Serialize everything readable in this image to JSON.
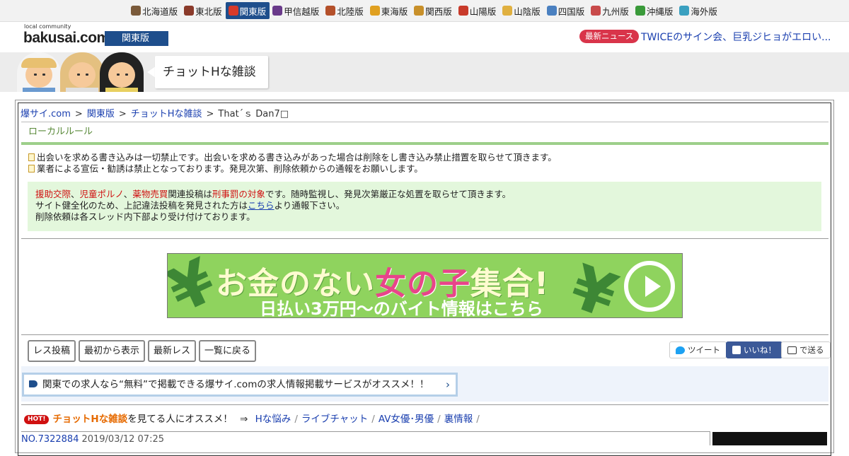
{
  "regions": [
    {
      "label": "北海道版",
      "color": "#7a5a3a",
      "icon": "cow-icon"
    },
    {
      "label": "東北版",
      "color": "#8a3a2a",
      "icon": "mask-icon"
    },
    {
      "label": "関東版",
      "color": "#d83a2a",
      "icon": "tower-icon",
      "active": true
    },
    {
      "label": "甲信越版",
      "color": "#6a3a8a",
      "icon": "grape-icon"
    },
    {
      "label": "北陸版",
      "color": "#b4502a",
      "icon": "gate-icon"
    },
    {
      "label": "東海版",
      "color": "#e0a020",
      "icon": "fish-icon"
    },
    {
      "label": "関西版",
      "color": "#c8902a",
      "icon": "takoyaki-icon"
    },
    {
      "label": "山陽版",
      "color": "#c83a2a",
      "icon": "shrine-icon"
    },
    {
      "label": "山陰版",
      "color": "#e0b040",
      "icon": "noodle-icon"
    },
    {
      "label": "四国版",
      "color": "#4a80c0",
      "icon": "bowl-icon"
    },
    {
      "label": "九州版",
      "color": "#c84a4a",
      "icon": "fish-icon"
    },
    {
      "label": "沖縄版",
      "color": "#3a9a3a",
      "icon": "shisa-icon"
    },
    {
      "label": "海外版",
      "color": "#3aa0c0",
      "icon": "globe-icon"
    }
  ],
  "header": {
    "logo_small": "local community",
    "logo_main": "bakusai.com",
    "region_badge": "関東版",
    "news_badge": "最新ニュース",
    "news_text": "TWICEのサイン会、巨乳ジヒョがエロい..."
  },
  "board": {
    "title": "チョットHな雑談"
  },
  "breadcrumb": {
    "items": [
      "爆サイ.com",
      "関東版",
      "チョットHな雑談"
    ],
    "separator": ">",
    "current": "That´ｓ Dan7□"
  },
  "local_rules": {
    "title": "ローカルルール",
    "lines": [
      "出会いを求める書き込みは一切禁止です。出会いを求める書き込みがあった場合は削除をし書き込み禁止措置を取らせて頂きます。",
      "業者による宣伝・勧誘は禁止となっております。発見次第、削除依頼からの通報をお願いします。"
    ]
  },
  "notice": {
    "red1": "援助交際",
    "comma1": "、",
    "red2": "児童ポルノ",
    "comma2": "、",
    "red3": "薬物売買",
    "mid1": "関連投稿は",
    "red4": "刑事罰の対象",
    "tail1": "です。随時監視し、発見次第厳正な処置を取らせて頂きます。",
    "line2_a": "サイト健全化のため、上記違法投稿を発見された方は",
    "line2_link": "こちら",
    "line2_b": "より通報下さい。",
    "line3": "削除依頼は各スレッド内下部より受け付けております。"
  },
  "ad": {
    "title_a": "お金のない",
    "title_pink": "女の子",
    "title_b": "集合!",
    "subtitle": "日払い3万円～のバイト情報はこちら",
    "yen": "¥"
  },
  "toolbar": {
    "post": "レス投稿",
    "first": "最初から表示",
    "latest": "最新レス",
    "back": "一覧に戻る"
  },
  "share": {
    "tweet": "ツイート",
    "like": "いいね！",
    "mail": "で送る"
  },
  "promo": {
    "text": "関東での求人なら“無料”で掲載できる爆サイ.comの求人情報掲載サービスがオススメ！！",
    "chevron": "›"
  },
  "recommend": {
    "hot": "HOT!",
    "board": "チョットHな雑談",
    "text": "を見てる人にオススメ！",
    "arrow": "⇒",
    "links": [
      "Hな悩み",
      "ライブチャット",
      "AV女優･男優",
      "裏情報"
    ],
    "slash": "/"
  },
  "post": {
    "no": "NO.7322884",
    "date": "2019/03/12 07:25"
  }
}
